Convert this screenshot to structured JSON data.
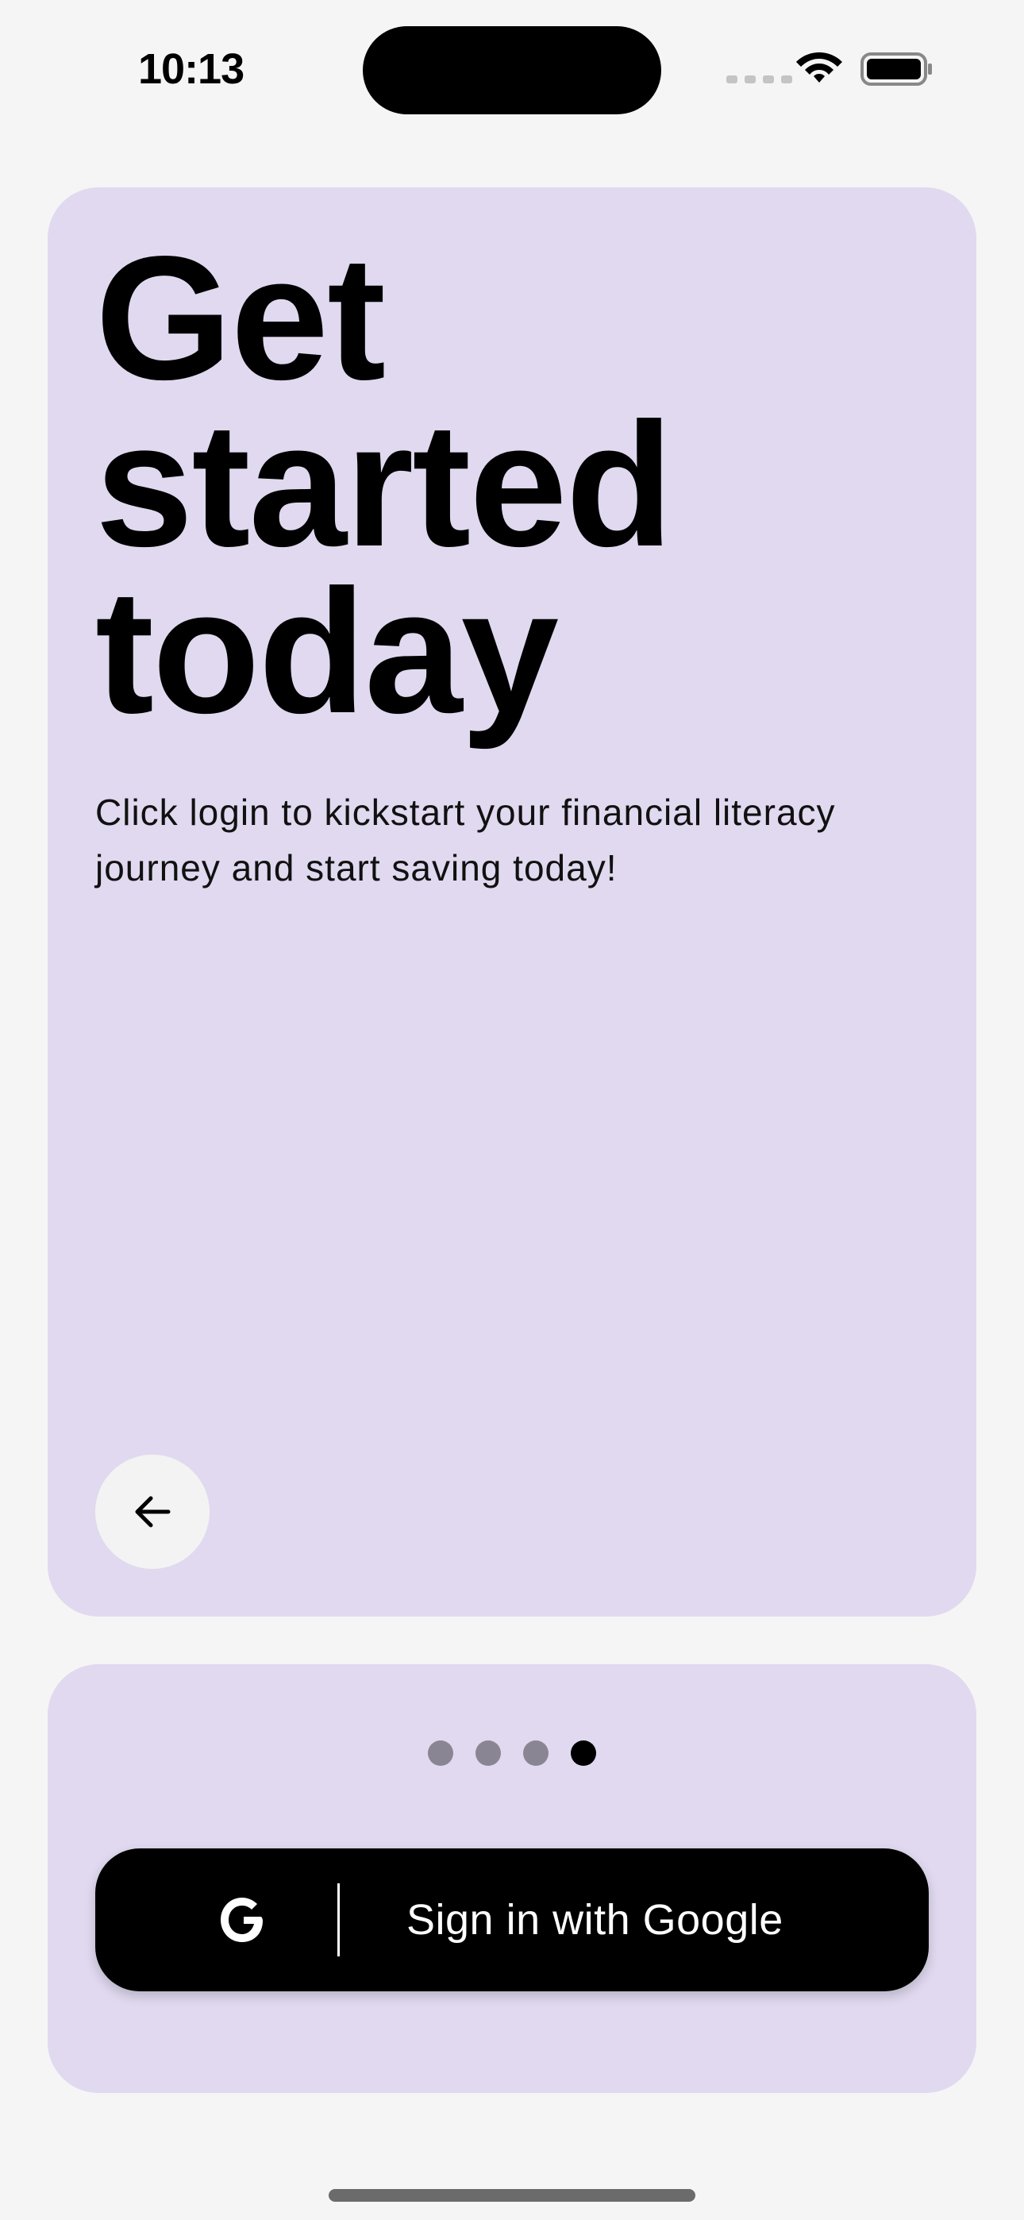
{
  "status_bar": {
    "time": "10:13",
    "icons": [
      "cellular-signal-icon",
      "wifi-icon",
      "battery-icon"
    ]
  },
  "hero": {
    "title": "Get\nstarted\ntoday",
    "subtitle": "Click login to kickstart your financial literacy journey and start saving today!",
    "back_icon": "arrow-left-icon"
  },
  "pagination": {
    "total": 4,
    "active_index": 3
  },
  "sign_in": {
    "label": "Sign in with Google",
    "icon": "google-g-icon"
  },
  "colors": {
    "background": "#f5f5f5",
    "card": "#e0d9ef",
    "button": "#000000",
    "dot_inactive": "#8a8592",
    "dot_active": "#000000"
  }
}
